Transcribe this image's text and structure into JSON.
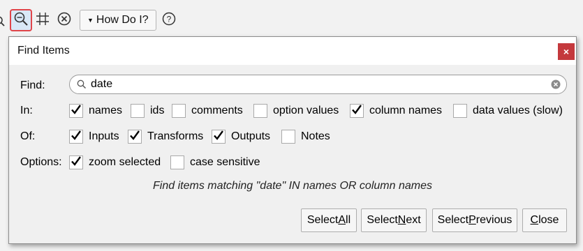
{
  "toolbar": {
    "how_do_i_label": "How Do I?",
    "icons": [
      "zoom-search-icon",
      "grid-icon",
      "cancel-icon",
      "help-icon"
    ]
  },
  "dialog": {
    "title": "Find Items",
    "close_label": "×",
    "find": {
      "label": "Find:",
      "value": "date"
    },
    "in": {
      "label": "In:",
      "options": [
        {
          "label": "names",
          "checked": true
        },
        {
          "label": "ids",
          "checked": false
        },
        {
          "label": "comments",
          "checked": false
        },
        {
          "label": "option values",
          "checked": false
        },
        {
          "label": "column names",
          "checked": true
        },
        {
          "label": "data values (slow)",
          "checked": false
        }
      ]
    },
    "of": {
      "label": "Of:",
      "options": [
        {
          "label": "Inputs",
          "checked": true
        },
        {
          "label": "Transforms",
          "checked": true
        },
        {
          "label": "Outputs",
          "checked": true
        },
        {
          "label": "Notes",
          "checked": false
        }
      ]
    },
    "options": {
      "label": "Options:",
      "items": [
        {
          "label": "zoom selected",
          "checked": true
        },
        {
          "label": "case sensitive",
          "checked": false
        }
      ]
    },
    "summary": "Find items matching \"date\" IN names OR column names",
    "buttons": {
      "select_all": {
        "pre": "Select ",
        "key": "A",
        "post": "ll"
      },
      "select_next": {
        "pre": "Select ",
        "key": "N",
        "post": "ext"
      },
      "select_previous": {
        "pre": "Select ",
        "key": "P",
        "post": "revious"
      },
      "close": {
        "pre": "",
        "key": "C",
        "post": "lose"
      }
    }
  },
  "colors": {
    "accent_red": "#c4393d",
    "highlight_border": "#e0454a",
    "dialog_body": "#f0f0f0"
  }
}
